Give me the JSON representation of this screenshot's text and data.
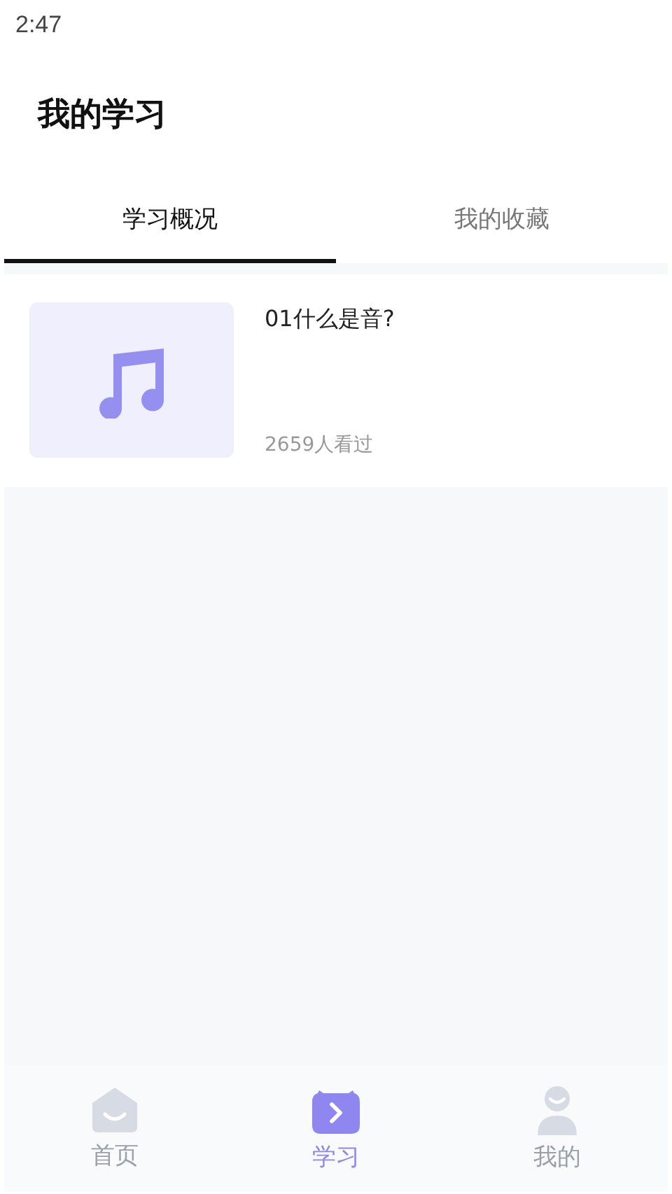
{
  "status_bar": {
    "time": "2:47"
  },
  "header": {
    "title": "我的学习"
  },
  "tabs": [
    {
      "label": "学习概况",
      "selected": true
    },
    {
      "label": "我的收藏",
      "selected": false
    }
  ],
  "courses": [
    {
      "title": "01什么是音?",
      "views": "2659人看过"
    }
  ],
  "bottom_nav": [
    {
      "label": "首页",
      "kind": "home",
      "selected": false
    },
    {
      "label": "学习",
      "kind": "study",
      "selected": true
    },
    {
      "label": "我的",
      "kind": "profile",
      "selected": false
    }
  ]
}
